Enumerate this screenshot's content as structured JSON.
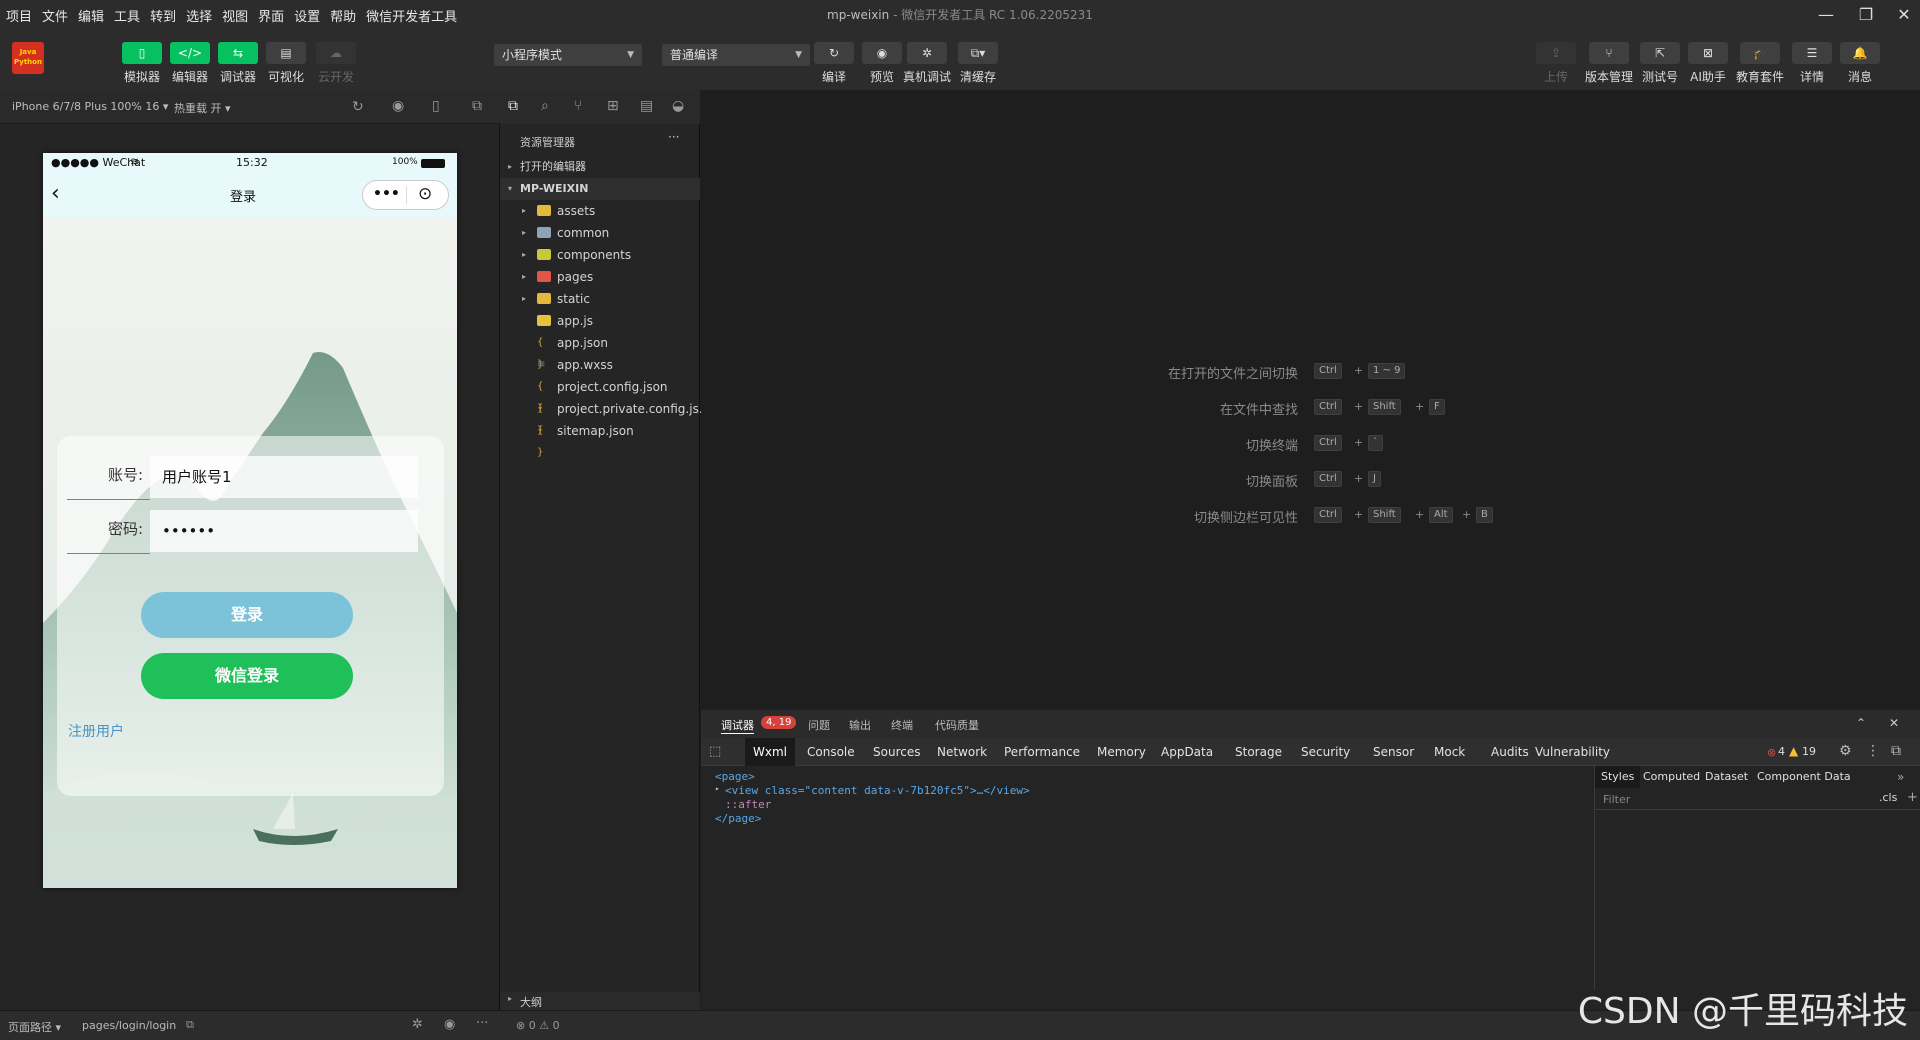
{
  "menu": [
    "项目",
    "文件",
    "编辑",
    "工具",
    "转到",
    "选择",
    "视图",
    "界面",
    "设置",
    "帮助",
    "微信开发者工具"
  ],
  "window": {
    "app_name": "mp-weixin",
    "title_suffix": "微信开发者工具 RC 1.06.2205231",
    "min": "—",
    "max": "❐",
    "close": "✕"
  },
  "logo_text": [
    "Java",
    "Python"
  ],
  "toolbar": {
    "left": [
      {
        "label": "模拟器",
        "glyph": "▯"
      },
      {
        "label": "编辑器",
        "glyph": "</>"
      },
      {
        "label": "调试器",
        "glyph": "⇆"
      },
      {
        "label": "可视化",
        "glyph": "▤"
      },
      {
        "label": "云开发",
        "glyph": "☁"
      }
    ],
    "mode_select": "小程序模式",
    "compile_select": "普通编译",
    "center": [
      {
        "label": "编译",
        "glyph": "↻"
      },
      {
        "label": "预览",
        "glyph": "◉"
      },
      {
        "label": "真机调试",
        "glyph": "✲"
      },
      {
        "label": "清缓存",
        "glyph": "⧉▾"
      }
    ],
    "right": [
      {
        "label": "上传",
        "glyph": "⇪"
      },
      {
        "label": "版本管理",
        "glyph": "⑂"
      },
      {
        "label": "测试号",
        "glyph": "⇱"
      },
      {
        "label": "AI助手",
        "glyph": "⊠"
      },
      {
        "label": "教育套件",
        "glyph": "🎓"
      },
      {
        "label": "详情",
        "glyph": "☰"
      },
      {
        "label": "消息",
        "glyph": "🔔"
      }
    ]
  },
  "simbar": {
    "device": "iPhone 6/7/8 Plus 100% 16 ▾",
    "hotreload": "热重载 开 ▾"
  },
  "phone": {
    "carrier": "●●●●● WeChat",
    "time": "15:32",
    "battery": "100%",
    "nav_title": "登录",
    "account_label": "账号:",
    "account_value": "用户账号1",
    "password_label": "密码:",
    "password_value": "••••••",
    "login_btn": "登录",
    "wechat_login_btn": "微信登录",
    "register_link": "注册用户",
    "colors": {
      "login": "#7cc3d9",
      "wechat": "#1fc059",
      "link": "#4a92c6"
    }
  },
  "explorer": {
    "title": "资源管理器",
    "more": "···",
    "open_editors": "打开的编辑器",
    "root": "MP-WEIXIN",
    "items": [
      {
        "name": "assets",
        "type": "folder",
        "color": "#e5b93c",
        "arrow": "▸"
      },
      {
        "name": "common",
        "type": "folder",
        "color": "#8fa3b8",
        "arrow": "▸"
      },
      {
        "name": "components",
        "type": "folder",
        "color": "#c7c83c",
        "arrow": "▸"
      },
      {
        "name": "pages",
        "type": "folder",
        "color": "#e2554a",
        "arrow": "▸"
      },
      {
        "name": "static",
        "type": "folder",
        "color": "#e5b93c",
        "arrow": "▸"
      },
      {
        "name": "app.js",
        "type": "file",
        "color": "#e5c23c",
        "arrow": ""
      },
      {
        "name": "app.json",
        "type": "json",
        "color": "#d5a538",
        "arrow": ""
      },
      {
        "name": "app.wxss",
        "type": "css",
        "color": "#4a8fd6",
        "arrow": ""
      },
      {
        "name": "project.config.json",
        "type": "json",
        "color": "#d5a538",
        "arrow": ""
      },
      {
        "name": "project.private.config.js...",
        "type": "json",
        "color": "#d5a538",
        "arrow": ""
      },
      {
        "name": "sitemap.json",
        "type": "json",
        "color": "#d5a538",
        "arrow": ""
      }
    ],
    "outline": "大纲",
    "status": "⊗ 0 ⚠ 0"
  },
  "shortcuts": [
    {
      "label": "在打开的文件之间切换",
      "keys": [
        "Ctrl",
        "1 ~ 9"
      ]
    },
    {
      "label": "在文件中查找",
      "keys": [
        "Ctrl",
        "Shift",
        "F"
      ]
    },
    {
      "label": "切换终端",
      "keys": [
        "Ctrl",
        "`"
      ]
    },
    {
      "label": "切换面板",
      "keys": [
        "Ctrl",
        "J"
      ]
    },
    {
      "label": "切换侧边栏可见性",
      "keys": [
        "Ctrl",
        "Shift",
        "Alt",
        "B"
      ]
    }
  ],
  "debugger": {
    "tabs": [
      "调试器",
      "问题",
      "输出",
      "终端",
      "代码质量"
    ],
    "badge": "4, 19",
    "devtools": [
      "Wxml",
      "Console",
      "Sources",
      "Network",
      "Performance",
      "Memory",
      "AppData",
      "Storage",
      "Security",
      "Sensor",
      "Mock",
      "Audits",
      "Vulnerability"
    ],
    "errors": "4",
    "warnings": "19",
    "code": [
      "<page>",
      "<view class=\"content data-v-7b120fc5\">…</view>",
      "::after",
      "</page>"
    ],
    "styles_tabs": [
      "Styles",
      "Computed",
      "Dataset",
      "Component Data"
    ],
    "filter_placeholder": "Filter",
    "cls": ".cls",
    "plus": "+"
  },
  "bottom": {
    "path_label": "页面路径 ▾",
    "path": "pages/login/login"
  },
  "watermark": "CSDN @千里码科技"
}
